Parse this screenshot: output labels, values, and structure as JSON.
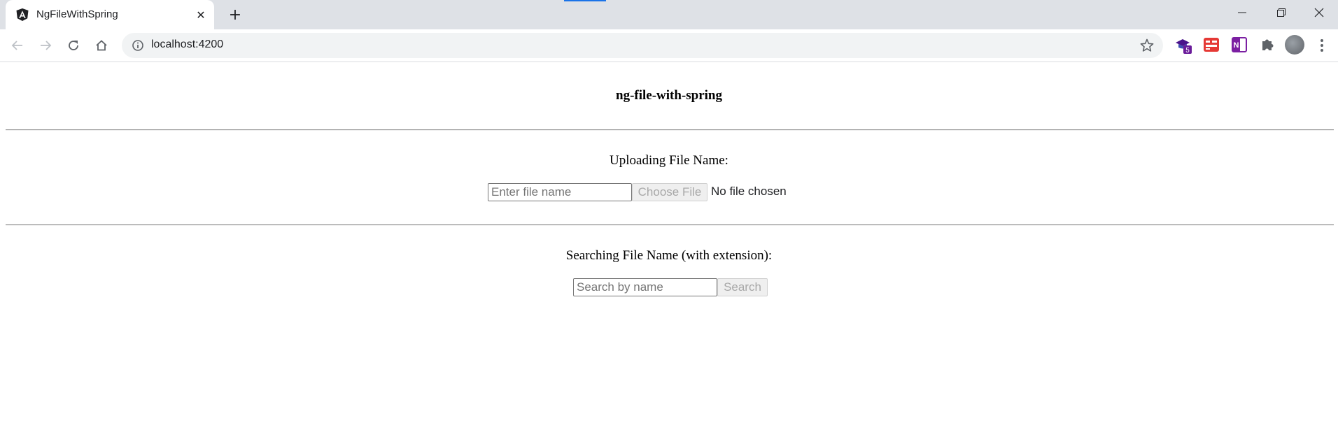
{
  "browser": {
    "tab": {
      "title": "NgFileWithSpring",
      "close_glyph": "✕"
    },
    "new_tab_glyph": "+",
    "url": "localhost:4200",
    "extensions": [
      {
        "icon": "graduation-cap-icon",
        "badge": "5",
        "color": "#4a148c"
      },
      {
        "icon": "red-extension-icon",
        "color": "#e53935"
      },
      {
        "icon": "onenote-icon",
        "color": "#7b1fa2"
      },
      {
        "icon": "puzzle-icon",
        "color": "#5f6368"
      }
    ]
  },
  "page": {
    "title": "ng-file-with-spring",
    "upload": {
      "label": "Uploading File Name:",
      "input_placeholder": "Enter file name",
      "choose_file_label": "Choose File",
      "file_status": "No file chosen"
    },
    "search": {
      "label": "Searching File Name (with extension):",
      "input_placeholder": "Search by name",
      "search_button_label": "Search"
    }
  },
  "colors": {
    "tabstrip_bg": "#dee1e6",
    "omnibox_bg": "#f1f3f4",
    "disabled_button_text": "#a8a8a8"
  }
}
